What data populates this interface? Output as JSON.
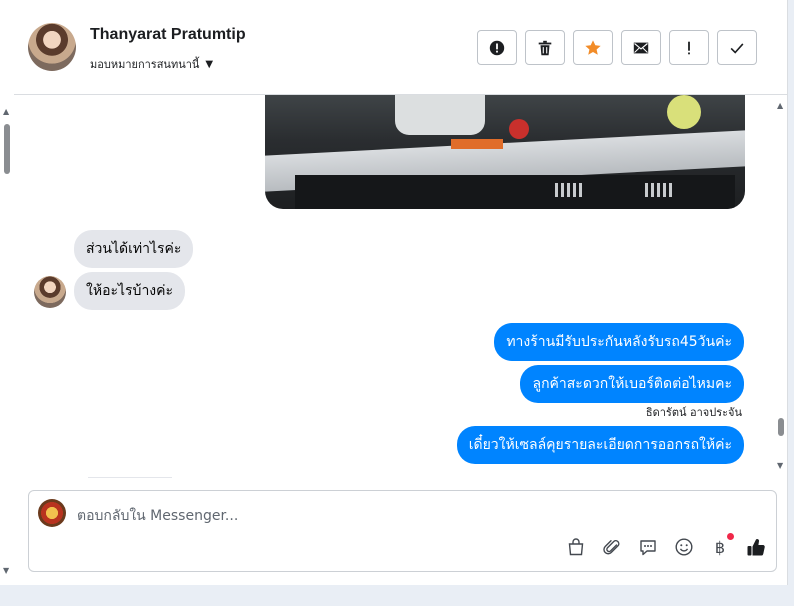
{
  "header": {
    "contact_name": "Thanyarat Pratumtip",
    "assign_label": "มอบหมายการสนทนานี้",
    "actions": [
      {
        "name": "report-icon",
        "glyph": "!"
      },
      {
        "name": "trash-icon"
      },
      {
        "name": "star-icon",
        "color": "#f28c28"
      },
      {
        "name": "mail-icon"
      },
      {
        "name": "exclamation-icon",
        "glyph": "!"
      },
      {
        "name": "check-icon"
      }
    ]
  },
  "messages": {
    "incoming": [
      "ส่วนได้เท่าไรค่ะ",
      "ให้อะไรบ้างค่ะ"
    ],
    "outgoing": [
      "ทางร้านมีรับประกันหลังรับรถ45วันค่ะ",
      "ลูกค้าสะดวกให้เบอร์ติดต่อไหมคะ",
      "เดี๋ยวให้เซลล์คุยรายละเอียดการออกรถให้ค่ะ"
    ],
    "sender_note": "ธิดารัตน์ อาจประจัน"
  },
  "composer": {
    "placeholder": "ตอบกลับใน Messenger...",
    "tools": [
      "bag-icon",
      "paperclip-icon",
      "chat-bubble-icon",
      "emoji-icon",
      "baht-icon",
      "thumbs-up-icon"
    ],
    "baht_glyph": "฿"
  },
  "colors": {
    "outgoing_bubble": "#0084ff",
    "incoming_bubble": "#e4e6eb",
    "star": "#f28c28",
    "notification_dot": "#f02849"
  }
}
